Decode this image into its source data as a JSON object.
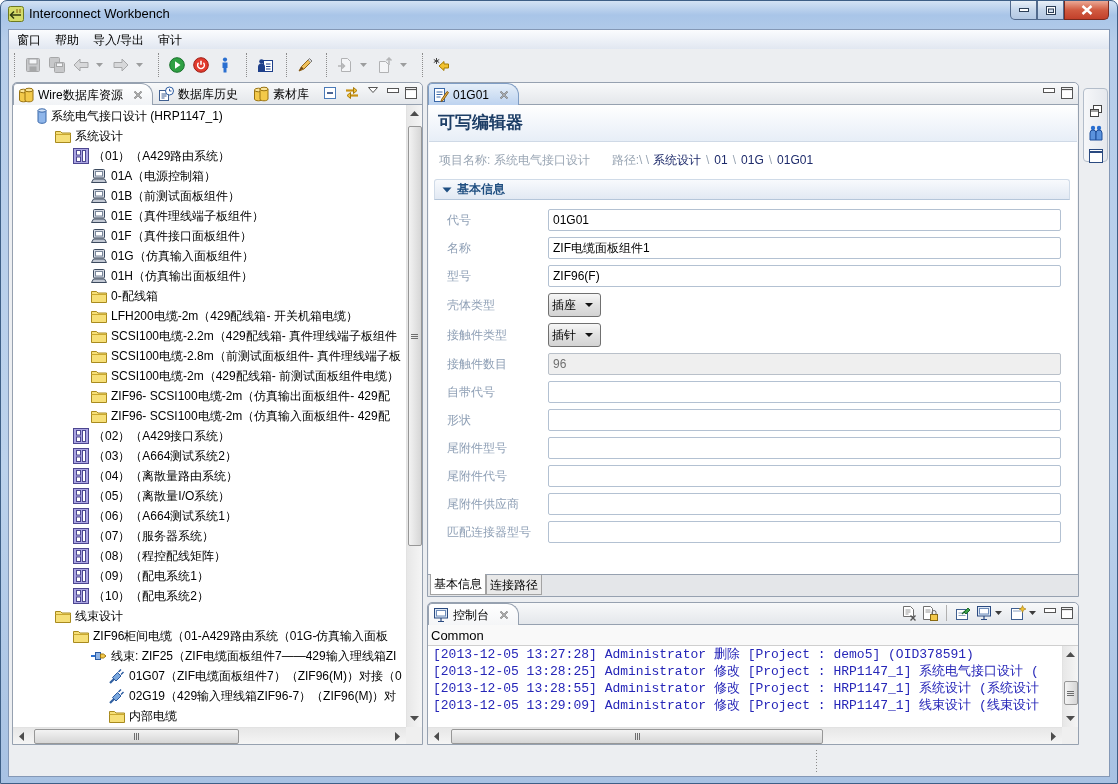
{
  "window": {
    "title": "Interconnect Workbench"
  },
  "menu": [
    {
      "label": "窗口"
    },
    {
      "label": "帮助"
    },
    {
      "label": "导入/导出"
    },
    {
      "label": "审计"
    }
  ],
  "toolbar": [
    {
      "items": [
        {
          "kind": "save",
          "disabled": true,
          "has_menu": false
        },
        {
          "kind": "saveall",
          "disabled": true,
          "has_menu": false
        },
        {
          "kind": "back",
          "disabled": true,
          "has_menu": true
        },
        {
          "kind": "forward",
          "disabled": true,
          "has_menu": true
        }
      ]
    },
    {
      "items": [
        {
          "kind": "run",
          "disabled": false,
          "has_menu": false
        },
        {
          "kind": "stop",
          "disabled": false,
          "has_menu": false
        },
        {
          "kind": "person",
          "disabled": false,
          "has_menu": false
        }
      ]
    },
    {
      "items": [
        {
          "kind": "contact",
          "disabled": false,
          "has_menu": false
        }
      ]
    },
    {
      "items": [
        {
          "kind": "brush",
          "disabled": false,
          "has_menu": false
        }
      ]
    },
    {
      "items": [
        {
          "kind": "import",
          "disabled": true,
          "has_menu": true
        },
        {
          "kind": "export",
          "disabled": true,
          "has_menu": true
        }
      ]
    },
    {
      "items": [
        {
          "kind": "starback",
          "disabled": false,
          "has_menu": false
        }
      ]
    }
  ],
  "resource_view": {
    "tabs": [
      {
        "label": "Wire数据库资源",
        "kind": "database",
        "selected": true
      },
      {
        "label": "数据库历史",
        "kind": "history",
        "selected": false
      },
      {
        "label": "素材库",
        "kind": "library",
        "selected": false
      }
    ],
    "tree": [
      {
        "label": "系统电气接口设计 (HRP1147_1)",
        "kind": "database",
        "children": [
          {
            "label": "系统设计",
            "kind": "folder",
            "children": [
              {
                "label": "（01）（A429路由系统）",
                "kind": "system",
                "children": [
                  {
                    "label": "01A（电源控制箱）",
                    "kind": "device"
                  },
                  {
                    "label": "01B（前测试面板组件）",
                    "kind": "device"
                  },
                  {
                    "label": "01E（真件理线端子板组件）",
                    "kind": "device"
                  },
                  {
                    "label": "01F（真件接口面板组件）",
                    "kind": "device"
                  },
                  {
                    "label": "01G（仿真输入面板组件）",
                    "kind": "device"
                  },
                  {
                    "label": "01H（仿真输出面板组件）",
                    "kind": "device"
                  },
                  {
                    "label": "0-配线箱",
                    "kind": "folder"
                  },
                  {
                    "label": "LFH200电缆-2m（429配线箱- 开关机箱电缆）",
                    "kind": "folder"
                  },
                  {
                    "label": "SCSI100电缆-2.2m（429配线箱- 真件理线端子板组件",
                    "kind": "folder"
                  },
                  {
                    "label": "SCSI100电缆-2.8m（前测试面板组件- 真件理线端子板",
                    "kind": "folder"
                  },
                  {
                    "label": "SCSI100电缆-2m（429配线箱- 前测试面板组件电缆）",
                    "kind": "folder"
                  },
                  {
                    "label": "ZIF96- SCSI100电缆-2m（仿真输出面板组件- 429配",
                    "kind": "folder"
                  },
                  {
                    "label": "ZIF96- SCSI100电缆-2m（仿真输入面板组件- 429配",
                    "kind": "folder"
                  }
                ]
              },
              {
                "label": "（02）（A429接口系统）",
                "kind": "system"
              },
              {
                "label": "（03）（A664测试系统2）",
                "kind": "system"
              },
              {
                "label": "（04）（离散量路由系统）",
                "kind": "system"
              },
              {
                "label": "（05）（离散量I/O系统）",
                "kind": "system"
              },
              {
                "label": "（06）（A664测试系统1）",
                "kind": "system"
              },
              {
                "label": "（07）（服务器系统）",
                "kind": "system"
              },
              {
                "label": "（08）（程控配线矩阵）",
                "kind": "system"
              },
              {
                "label": "（09）（配电系统1）",
                "kind": "system"
              },
              {
                "label": "（10）（配电系统2）",
                "kind": "system"
              }
            ]
          },
          {
            "label": "线束设计",
            "kind": "folder",
            "children": [
              {
                "label": "ZIF96柜间电缆（01-A429路由系统（01G-仿真输入面板",
                "kind": "folder",
                "children": [
                  {
                    "label": "线束: ZIF25（ZIF电缆面板组件7——429输入理线箱ZI",
                    "kind": "harness",
                    "children": [
                      {
                        "label": "01G07（ZIF电缆面板组件7）（ZIF96(M)）对接（0",
                        "kind": "plug"
                      },
                      {
                        "label": "02G19（429输入理线箱ZIF96-7）（ZIF96(M)）对",
                        "kind": "plug"
                      },
                      {
                        "label": "内部电缆",
                        "kind": "folder"
                      }
                    ]
                  }
                ]
              }
            ]
          }
        ]
      }
    ]
  },
  "editor": {
    "tab": {
      "label": "01G01"
    },
    "title": "可写编辑器",
    "project": "项目名称: 系统电气接口设计",
    "breadcrumb": [
      {
        "kind": "label",
        "text": "路径:\\ \\"
      },
      {
        "kind": "link",
        "text": "系统设计"
      },
      {
        "kind": "separator",
        "text": "\\"
      },
      {
        "kind": "link",
        "text": "01"
      },
      {
        "kind": "separator",
        "text": "\\"
      },
      {
        "kind": "link",
        "text": "01G"
      },
      {
        "kind": "separator",
        "text": "\\"
      },
      {
        "kind": "link",
        "text": "01G01"
      }
    ],
    "section": {
      "title": "基本信息",
      "expanded": true
    },
    "fields": [
      {
        "label": "代号",
        "kind": "text",
        "value": "01G01",
        "disabled": false
      },
      {
        "label": "名称",
        "kind": "text",
        "value": "ZIF电缆面板组件1",
        "disabled": false
      },
      {
        "label": "型号",
        "kind": "text",
        "value": "ZIF96(F)",
        "disabled": false
      },
      {
        "label": "壳体类型",
        "kind": "combo",
        "value": "插座",
        "disabled": false
      },
      {
        "label": "接触件类型",
        "kind": "combo",
        "value": "插针",
        "disabled": false
      },
      {
        "label": "接触件数目",
        "kind": "text",
        "value": "96",
        "disabled": true
      },
      {
        "label": "自带代号",
        "kind": "text",
        "disabled": false
      },
      {
        "label": "形状",
        "kind": "text",
        "disabled": false
      },
      {
        "label": "尾附件型号",
        "kind": "text",
        "disabled": false
      },
      {
        "label": "尾附件代号",
        "kind": "text",
        "disabled": false
      },
      {
        "label": "尾附件供应商",
        "kind": "text",
        "disabled": false
      },
      {
        "label": "匹配连接器型号",
        "kind": "text",
        "disabled": false
      }
    ],
    "pages": [
      {
        "label": "基本信息",
        "selected": true
      },
      {
        "label": "连接路径",
        "selected": false
      }
    ]
  },
  "console": {
    "tab": {
      "label": "控制台"
    },
    "name": "Common",
    "lines": [
      "[2013-12-05 13:27:28] Administrator 删除 [Project : demo5] (OID378591)",
      "[2013-12-05 13:28:25] Administrator 修改 [Project : HRP1147_1] 系统电气接口设计 (",
      "[2013-12-05 13:28:55] Administrator 修改 [Project : HRP1147_1] 系统设计 (系统设计",
      "[2013-12-05 13:29:09] Administrator 修改 [Project : HRP1147_1] 线束设计 (线束设计"
    ]
  }
}
